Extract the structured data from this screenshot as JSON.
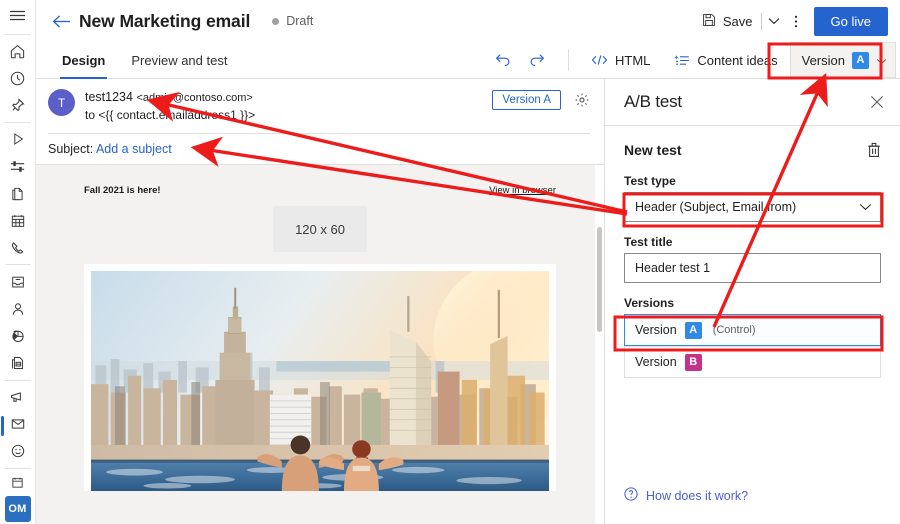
{
  "rail": {
    "items": [
      {
        "name": "hamburger-menu",
        "label": "Menu"
      },
      {
        "name": "home",
        "label": "Home"
      },
      {
        "name": "recent",
        "label": "Recent"
      },
      {
        "name": "pinned",
        "label": "Pinned"
      },
      {
        "name": "play",
        "label": "Get started"
      },
      {
        "name": "settings-sliders",
        "label": "Customer journeys"
      },
      {
        "name": "documents",
        "label": "Content"
      },
      {
        "name": "calendar",
        "label": "Events"
      },
      {
        "name": "phone",
        "label": "Calls"
      },
      {
        "name": "inbox",
        "label": "Inbox"
      },
      {
        "name": "contacts",
        "label": "Contacts"
      },
      {
        "name": "analytics-pie",
        "label": "Analytics"
      },
      {
        "name": "forms",
        "label": "Forms"
      },
      {
        "name": "megaphone",
        "label": "Marketing"
      },
      {
        "name": "email",
        "label": "Emails"
      },
      {
        "name": "smiley",
        "label": "Feedback"
      },
      {
        "name": "calendar-small",
        "label": "Calendar"
      }
    ],
    "org_badge": "OM"
  },
  "cmdbar": {
    "back_icon": "back-arrow-icon",
    "title": "New Marketing email",
    "status": "Draft",
    "save_label": "Save",
    "save_icon": "save-disk-icon",
    "more_icon": "more-vertical-icon",
    "golive_label": "Go live"
  },
  "tabs": {
    "items": [
      {
        "label": "Design",
        "active": true
      },
      {
        "label": "Preview and test",
        "active": false
      }
    ],
    "undo_icon": "undo-icon",
    "redo_icon": "redo-icon",
    "html_label": "HTML",
    "html_icon": "code-icon",
    "content_ideas_label": "Content ideas",
    "content_ideas_icon": "content-ideas-icon",
    "version_label": "Version",
    "version_badge": "A",
    "version_chevron": "chevron-down-icon"
  },
  "mail": {
    "avatar_initial": "T",
    "from_name": "test1234",
    "from_email": "<admin@contoso.com>",
    "to_line": "to <{{ contact.emailaddress1 }}>",
    "version_button": "Version A",
    "settings_icon": "gear-icon",
    "subject_label": "Subject:",
    "subject_link": "Add a subject",
    "body": {
      "preheader": "Fall 2021 is here!",
      "view_in_browser": "View in browser",
      "logo_placeholder": "120 x 60",
      "hero_alt": "city-skyline-rooftop-pool-photo"
    }
  },
  "panel": {
    "title": "A/B test",
    "close_icon": "close-icon",
    "section_label": "New test",
    "delete_icon": "trash-icon",
    "test_type_label": "Test type",
    "test_type_value": "Header (Subject, Email from)",
    "test_type_chevron": "chevron-down-icon",
    "test_title_label": "Test title",
    "test_title_value": "Header test 1",
    "versions_label": "Versions",
    "versions": [
      {
        "label": "Version",
        "badge": "A",
        "note": "(Control)",
        "selected": true
      },
      {
        "label": "Version",
        "badge": "B",
        "note": "",
        "selected": false
      }
    ],
    "help_link": "How does it work?",
    "help_icon": "question-circle-icon"
  },
  "colors": {
    "accent": "#2564cf",
    "version_a": "#2e8ae6",
    "version_b": "#c4338a",
    "annotation": "#ee1b1b",
    "avatar": "#5b5fc7",
    "org_badge": "#2a6fc0"
  },
  "annotations": {
    "boxes": [
      {
        "name": "version-toolbar-highlight"
      },
      {
        "name": "test-type-highlight"
      },
      {
        "name": "version-a-row-highlight"
      }
    ],
    "arrows": [
      {
        "name": "arrow-test-type-to-from-address"
      },
      {
        "name": "arrow-test-type-to-subject"
      },
      {
        "name": "arrow-version-a-row-to-version-toolbar"
      }
    ]
  }
}
